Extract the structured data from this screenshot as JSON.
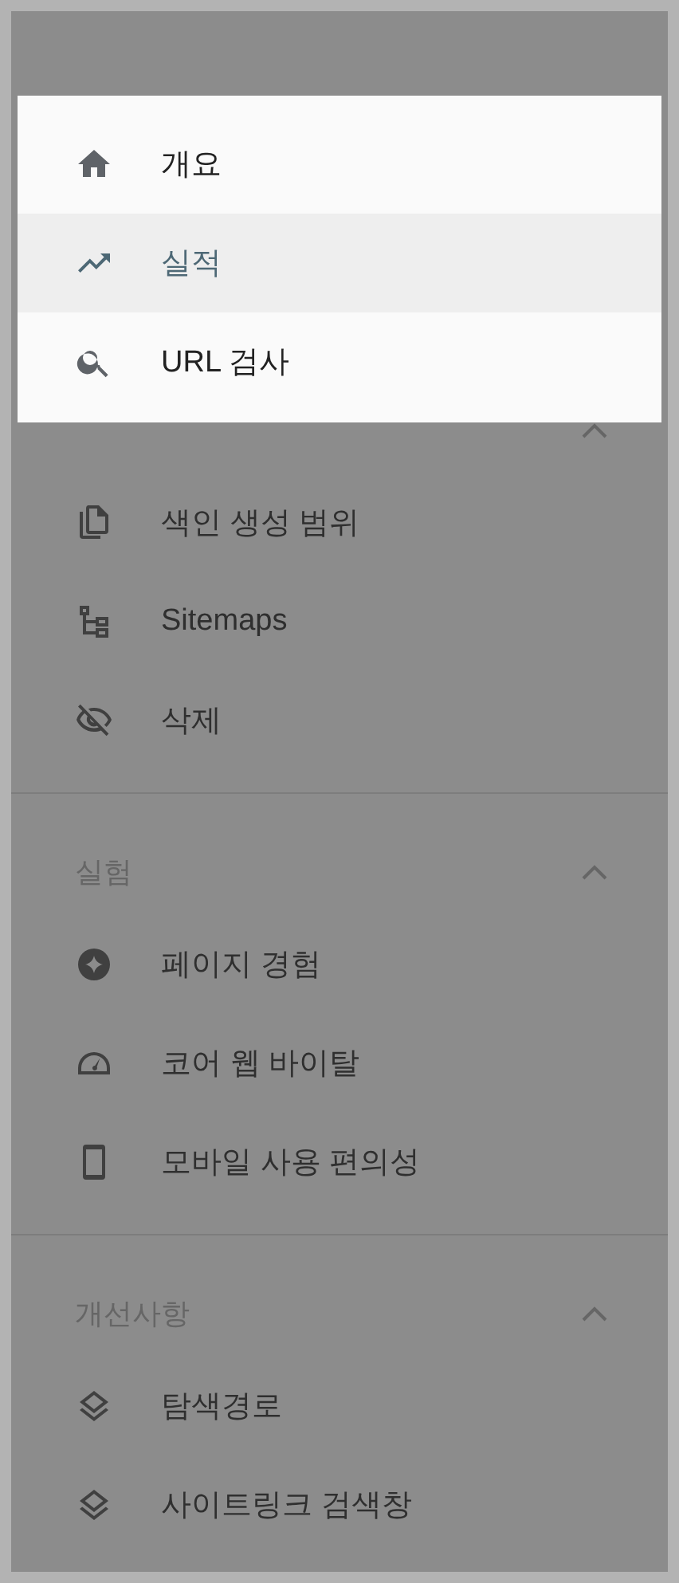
{
  "highlight_card": {
    "items": [
      {
        "label": "개요",
        "selected": false
      },
      {
        "label": "실적",
        "selected": true
      },
      {
        "label": "URL 검사",
        "selected": false
      }
    ]
  },
  "sections": [
    {
      "expanded": true,
      "items": [
        {
          "label": "색인 생성 범위"
        },
        {
          "label": "Sitemaps"
        },
        {
          "label": "삭제"
        }
      ]
    },
    {
      "title": "실험",
      "expanded": true,
      "items": [
        {
          "label": "페이지 경험"
        },
        {
          "label": "코어 웹 바이탈"
        },
        {
          "label": "모바일 사용 편의성"
        }
      ]
    },
    {
      "title": "개선사항",
      "expanded": true,
      "items": [
        {
          "label": "탐색경로"
        },
        {
          "label": "사이트링크 검색창"
        }
      ]
    }
  ]
}
